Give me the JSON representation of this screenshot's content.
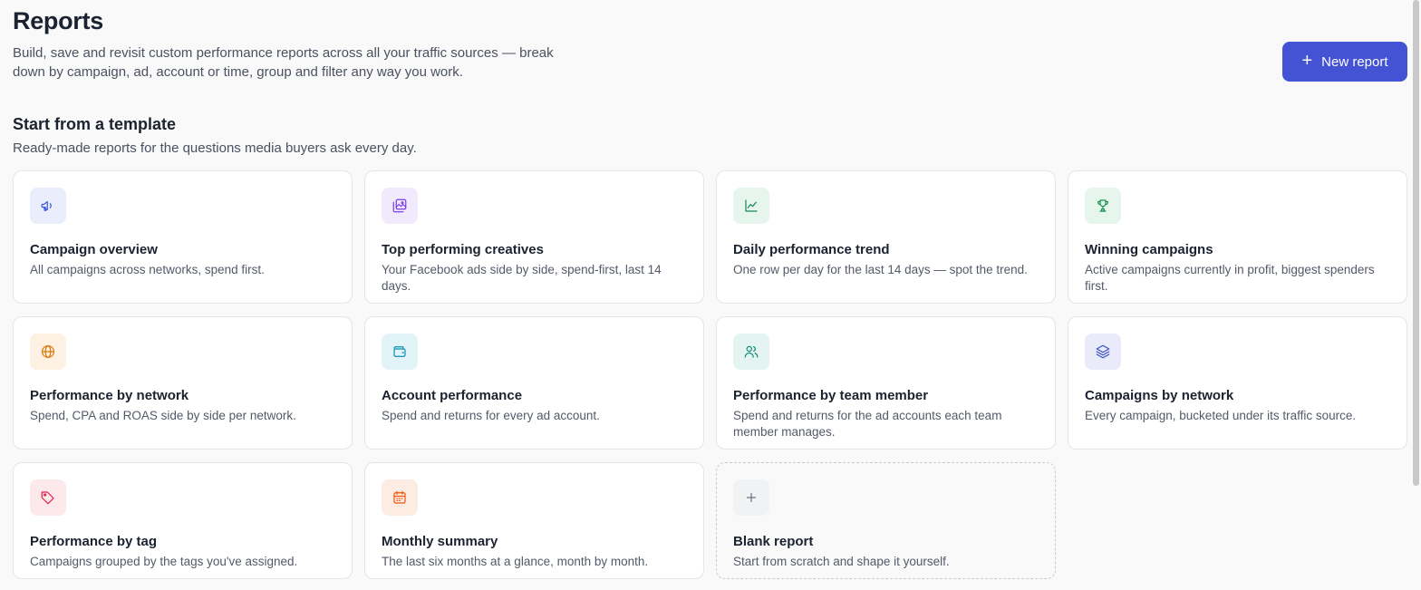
{
  "header": {
    "title": "Reports",
    "description": "Build, save and revisit custom performance reports across all your traffic sources — break down by campaign, ad, account or time, group and filter any way you work.",
    "new_report_label": "New report",
    "new_report_icon": "plus-icon"
  },
  "templates_section": {
    "title": "Start from a template",
    "subtitle": "Ready-made reports for the questions media buyers ask every day."
  },
  "templates": [
    {
      "title": "Campaign overview",
      "description": "All campaigns across networks, spend first.",
      "icon": "megaphone-icon",
      "icon_color": "#3b5bdb",
      "icon_bg": "#eaeefc"
    },
    {
      "title": "Top performing creatives",
      "description": "Your Facebook ads side by side, spend-first, last 14 days.",
      "icon": "images-icon",
      "icon_color": "#7c3aed",
      "icon_bg": "#f1eafd"
    },
    {
      "title": "Daily performance trend",
      "description": "One row per day for the last 14 days — spot the trend.",
      "icon": "line-chart-icon",
      "icon_color": "#16865a",
      "icon_bg": "#e6f5ee"
    },
    {
      "title": "Winning campaigns",
      "description": "Active campaigns currently in profit, biggest spenders first.",
      "icon": "trophy-icon",
      "icon_color": "#17924f",
      "icon_bg": "#e6f6ec"
    },
    {
      "title": "Performance by network",
      "description": "Spend, CPA and ROAS side by side per network.",
      "icon": "globe-icon",
      "icon_color": "#d97706",
      "icon_bg": "#fdf1e3"
    },
    {
      "title": "Account performance",
      "description": "Spend and returns for every ad account.",
      "icon": "wallet-icon",
      "icon_color": "#0891b2",
      "icon_bg": "#e3f4f8"
    },
    {
      "title": "Performance by team member",
      "description": "Spend and returns for the ad accounts each team member manages.",
      "icon": "users-icon",
      "icon_color": "#0f8a74",
      "icon_bg": "#e4f5f1"
    },
    {
      "title": "Campaigns by network",
      "description": "Every campaign, bucketed under its traffic source.",
      "icon": "layers-icon",
      "icon_color": "#3b4fc4",
      "icon_bg": "#e9ebfa"
    },
    {
      "title": "Performance by tag",
      "description": "Campaigns grouped by the tags you've assigned.",
      "icon": "tag-icon",
      "icon_color": "#e11d48",
      "icon_bg": "#fde8ec"
    },
    {
      "title": "Monthly summary",
      "description": "The last six months at a glance, month by month.",
      "icon": "calendar-icon",
      "icon_color": "#ea580c",
      "icon_bg": "#fdece2"
    },
    {
      "title": "Blank report",
      "description": "Start from scratch and shape it yourself.",
      "icon": "plus-icon",
      "icon_color": "#6b7280",
      "icon_bg": "#f1f2f4"
    }
  ],
  "colors": {
    "accent": "#4353d4",
    "background": "#f9f9f9"
  }
}
